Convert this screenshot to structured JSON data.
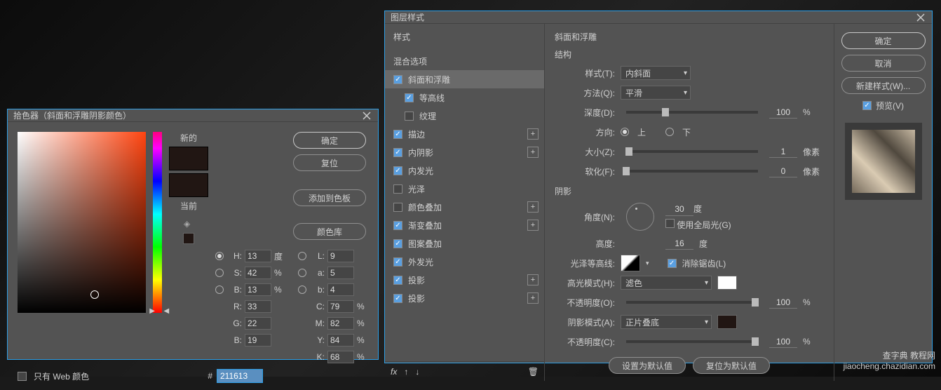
{
  "picker": {
    "title": "拾色器（斜面和浮雕阴影颜色）",
    "new_label": "新的",
    "current_label": "当前",
    "ok": "确定",
    "reset": "复位",
    "add_swatch": "添加到色板",
    "libraries": "颜色库",
    "web_only": "只有 Web 颜色",
    "hex_prefix": "#",
    "hex": "211613",
    "hsb": {
      "h": "13",
      "h_unit": "度",
      "s": "42",
      "s_unit": "%",
      "b": "13",
      "b_unit": "%"
    },
    "lab": {
      "l": "9",
      "a": "5",
      "b": "4"
    },
    "rgb": {
      "r": "33",
      "g": "22",
      "b": "19"
    },
    "cmyk": {
      "c": "79",
      "c_unit": "%",
      "m": "82",
      "m_unit": "%",
      "y": "84",
      "y_unit": "%",
      "k": "68",
      "k_unit": "%"
    }
  },
  "layer": {
    "title": "图层样式",
    "styles_header": "样式",
    "blend": "混合选项",
    "items": {
      "bevel": "斜面和浮雕",
      "contour": "等高线",
      "texture": "纹理",
      "stroke": "描边",
      "inner_shadow": "内阴影",
      "inner_glow": "内发光",
      "satin": "光泽",
      "color_overlay": "颜色叠加",
      "gradient_overlay": "渐变叠加",
      "pattern_overlay": "图案叠加",
      "outer_glow": "外发光",
      "drop_shadow1": "投影",
      "drop_shadow2": "投影"
    },
    "fx_label": "fx",
    "bevel_panel": {
      "title": "斜面和浮雕",
      "structure": "结构",
      "style": "样式(T):",
      "style_val": "内斜面",
      "technique": "方法(Q):",
      "technique_val": "平滑",
      "depth": "深度(D):",
      "depth_val": "100",
      "percent": "%",
      "direction": "方向:",
      "dir_up": "上",
      "dir_down": "下",
      "size": "大小(Z):",
      "size_val": "1",
      "px": "像素",
      "soften": "软化(F):",
      "soften_val": "0",
      "shading": "阴影",
      "angle": "角度(N):",
      "angle_val": "30",
      "deg": "度",
      "global": "使用全局光(G)",
      "altitude": "高度:",
      "altitude_val": "16",
      "gloss_contour": "光泽等高线:",
      "antialias": "消除锯齿(L)",
      "highlight_mode": "高光模式(H):",
      "highlight_val": "滤色",
      "highlight_opacity": "不透明度(O):",
      "highlight_opacity_val": "100",
      "shadow_mode": "阴影模式(A):",
      "shadow_val": "正片叠底",
      "shadow_opacity": "不透明度(C):",
      "shadow_opacity_val": "100",
      "make_default": "设置为默认值",
      "reset_default": "复位为默认值"
    },
    "right": {
      "ok": "确定",
      "cancel": "取消",
      "new_style": "新建样式(W)...",
      "preview": "预览(V)"
    }
  },
  "watermark": {
    "line1": "查字典 教程网",
    "line2": "jiaocheng.chazidian.com"
  }
}
